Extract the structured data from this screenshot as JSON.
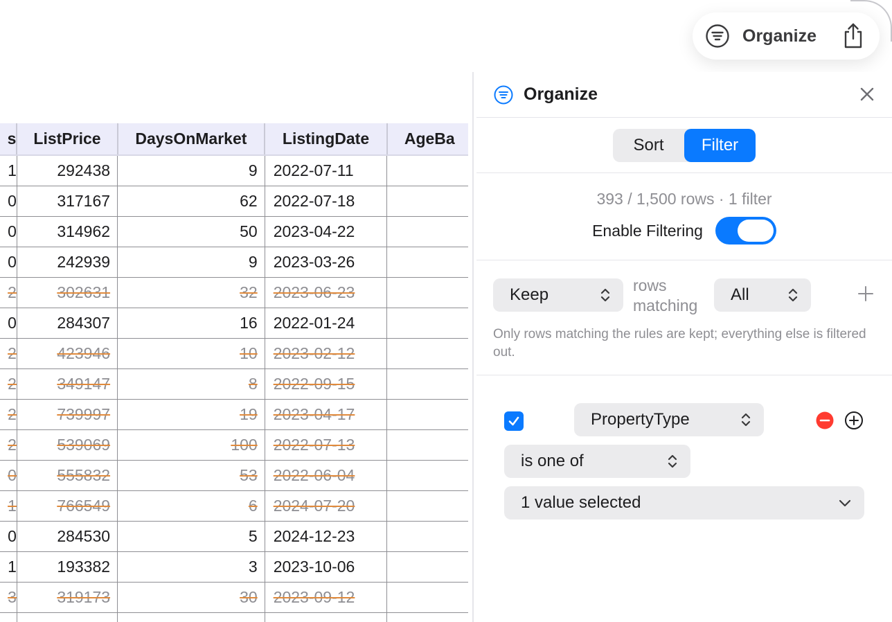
{
  "toolbar": {
    "organize_label": "Organize",
    "organize_icon": "filter-lines-icon",
    "share_icon": "share-icon"
  },
  "table": {
    "columns": [
      "s",
      "ListPrice",
      "DaysOnMarket",
      "ListingDate",
      "AgeBa"
    ],
    "rows": [
      {
        "c0": "1",
        "price": "292438",
        "days": "9",
        "date": "2022-07-11",
        "filtered": false
      },
      {
        "c0": "0",
        "price": "317167",
        "days": "62",
        "date": "2022-07-18",
        "filtered": false
      },
      {
        "c0": "0",
        "price": "314962",
        "days": "50",
        "date": "2023-04-22",
        "filtered": false
      },
      {
        "c0": "0",
        "price": "242939",
        "days": "9",
        "date": "2023-03-26",
        "filtered": false
      },
      {
        "c0": "2",
        "price": "302631",
        "days": "32",
        "date": "2023-06-23",
        "filtered": true
      },
      {
        "c0": "0",
        "price": "284307",
        "days": "16",
        "date": "2022-01-24",
        "filtered": false
      },
      {
        "c0": "2",
        "price": "423946",
        "days": "10",
        "date": "2023-02-12",
        "filtered": true
      },
      {
        "c0": "2",
        "price": "349147",
        "days": "8",
        "date": "2022-09-15",
        "filtered": true
      },
      {
        "c0": "2",
        "price": "739997",
        "days": "19",
        "date": "2023-04-17",
        "filtered": true
      },
      {
        "c0": "2",
        "price": "539069",
        "days": "100",
        "date": "2022-07-13",
        "filtered": true
      },
      {
        "c0": "0",
        "price": "555832",
        "days": "53",
        "date": "2022-06-04",
        "filtered": true
      },
      {
        "c0": "1",
        "price": "766549",
        "days": "6",
        "date": "2024-07-20",
        "filtered": true
      },
      {
        "c0": "0",
        "price": "284530",
        "days": "5",
        "date": "2024-12-23",
        "filtered": false
      },
      {
        "c0": "1",
        "price": "193382",
        "days": "3",
        "date": "2023-10-06",
        "filtered": false
      },
      {
        "c0": "3",
        "price": "319173",
        "days": "30",
        "date": "2023-09-12",
        "filtered": true
      },
      {
        "c0": "",
        "price": "",
        "days": "",
        "date": "",
        "filtered": false
      }
    ],
    "strike_color": "#e08a3c"
  },
  "panel": {
    "title": "Organize",
    "tabs": [
      "Sort",
      "Filter"
    ],
    "active_tab": "Filter",
    "row_count": "393 / 1,500 rows · 1 filter",
    "enable_label": "Enable Filtering",
    "enable_on": true,
    "mode": "Keep",
    "rows_matching_label": "rows matching",
    "match": "All",
    "description": "Only rows matching the rules are kept; everything else is filtered out.",
    "rule": {
      "enabled": true,
      "field": "PropertyType",
      "operator": "is one of",
      "value": "1 value selected"
    },
    "accent": "#0a7aff"
  }
}
